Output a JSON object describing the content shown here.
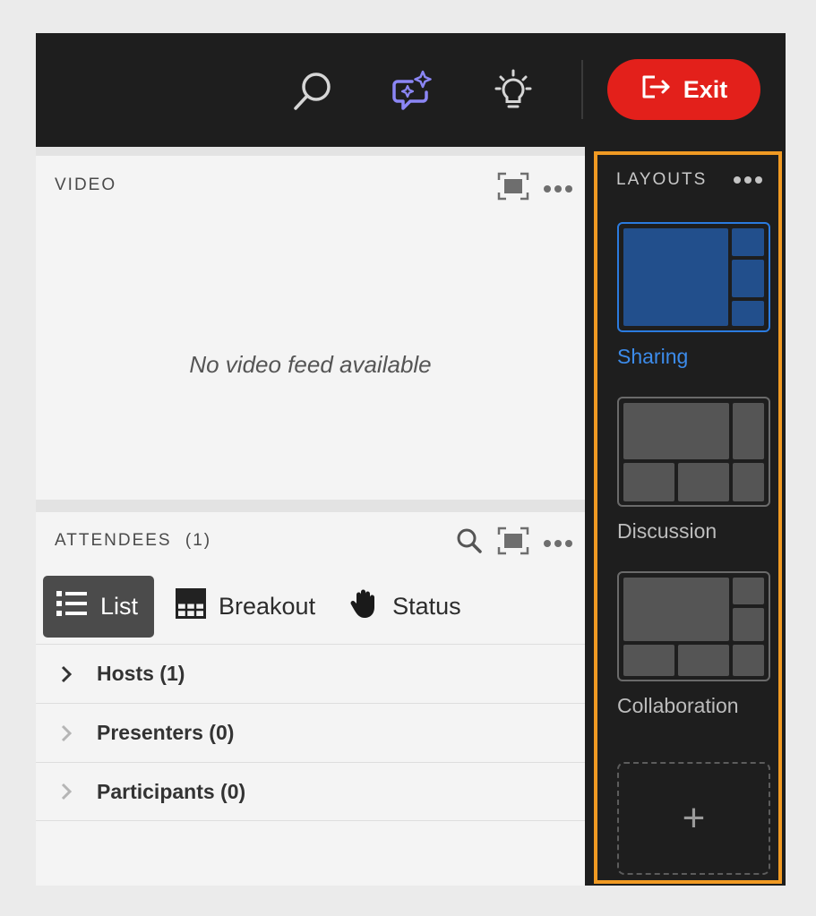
{
  "topbar": {
    "exit_label": "Exit",
    "icons": [
      "search-icon",
      "ai-chat-sparkle-icon",
      "lightbulb-icon",
      "exit-icon"
    ],
    "colors": {
      "ai_icon": "#8b86f5",
      "exit_button": "#e3201b"
    }
  },
  "video": {
    "title": "VIDEO",
    "empty_message": "No video feed available"
  },
  "attendees": {
    "title": "ATTENDEES",
    "count": "(1)",
    "tabs": [
      {
        "label": "List",
        "icon": "list-icon",
        "active": true
      },
      {
        "label": "Breakout",
        "icon": "breakout-grid-icon",
        "active": false
      },
      {
        "label": "Status",
        "icon": "raised-hand-icon",
        "active": false
      }
    ],
    "groups": [
      {
        "label": "Hosts (1)"
      },
      {
        "label": "Presenters (0)"
      },
      {
        "label": "Participants (0)"
      }
    ]
  },
  "layouts": {
    "title": "LAYOUTS",
    "items": [
      {
        "label": "Sharing",
        "selected": true
      },
      {
        "label": "Discussion",
        "selected": false
      },
      {
        "label": "Collaboration",
        "selected": false
      }
    ],
    "add_label": "+",
    "colors": {
      "highlight_border": "#f09a23",
      "selected": "#3c8bea"
    }
  }
}
